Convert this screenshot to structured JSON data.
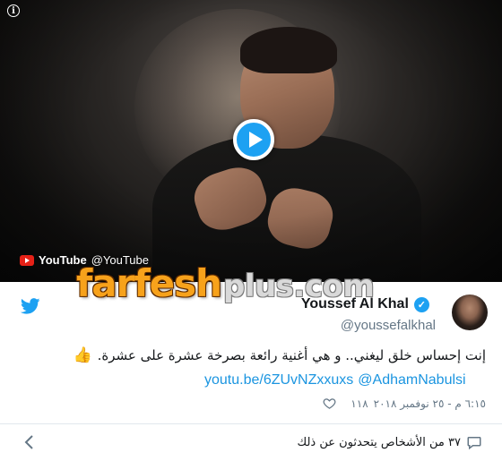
{
  "media": {
    "youtube_brand": "YouTube",
    "youtube_handle": "@YouTube"
  },
  "watermark": {
    "main": "farfesh",
    "sub": "plus.com"
  },
  "author": {
    "name": "Youssef Al Khal",
    "handle": "@youssefalkhal"
  },
  "tweet": {
    "text": "إنت إحساس خلق ليغني.. و هي أغنية رائعة بصرخة عشرة على عشرة.",
    "emoji": "👍",
    "link1": "youtu.be/6ZUvNZxxuxs",
    "link2": "@AdhamNabulsi",
    "timestamp": "٦:١٥ م - ٢٥ نوفمبر ٢٠١٨",
    "likes": "١١٨"
  },
  "footer": {
    "people_text": "٣٧ من الأشخاص يتحدثون عن ذلك"
  },
  "colors": {
    "twitter_blue": "#1da1f2",
    "link_blue": "#1b95e0",
    "watermark_orange": "#f7a21b"
  },
  "icons": [
    "info-icon",
    "play-icon",
    "youtube-logo-icon",
    "twitter-bird-icon",
    "verified-icon",
    "thumbs-up-icon",
    "heart-icon",
    "chevron-left-icon",
    "people-icon"
  ]
}
